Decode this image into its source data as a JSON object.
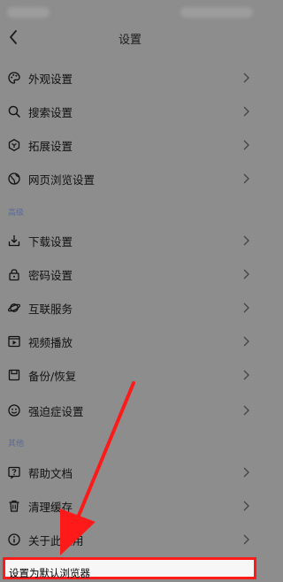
{
  "header": {
    "title": "设置"
  },
  "items_main": [
    {
      "label": "外观设置",
      "icon": "palette-icon"
    },
    {
      "label": "搜索设置",
      "icon": "search-icon"
    },
    {
      "label": "拓展设置",
      "icon": "extension-icon"
    },
    {
      "label": "网页浏览设置",
      "icon": "globe-icon"
    }
  ],
  "section_advanced": "高级",
  "items_advanced": [
    {
      "label": "下载设置",
      "icon": "download-icon"
    },
    {
      "label": "密码设置",
      "icon": "lock-icon"
    },
    {
      "label": "互联服务",
      "icon": "planet-icon"
    },
    {
      "label": "视频播放",
      "icon": "video-icon"
    },
    {
      "label": "备份/恢复",
      "icon": "save-icon"
    },
    {
      "label": "强迫症设置",
      "icon": "smiley-icon"
    }
  ],
  "section_other": "其他",
  "items_other": [
    {
      "label": "帮助文档",
      "icon": "help-icon"
    },
    {
      "label": "清理缓存",
      "icon": "trash-icon"
    },
    {
      "label": "关于此应用",
      "icon": "info-icon"
    }
  ],
  "highlighted_item": {
    "label": "设置为默认浏览器"
  },
  "colors": {
    "overlay": "#8d8d8d",
    "annotation_red": "#ff1a1a",
    "section_text": "#5a6a9a"
  }
}
